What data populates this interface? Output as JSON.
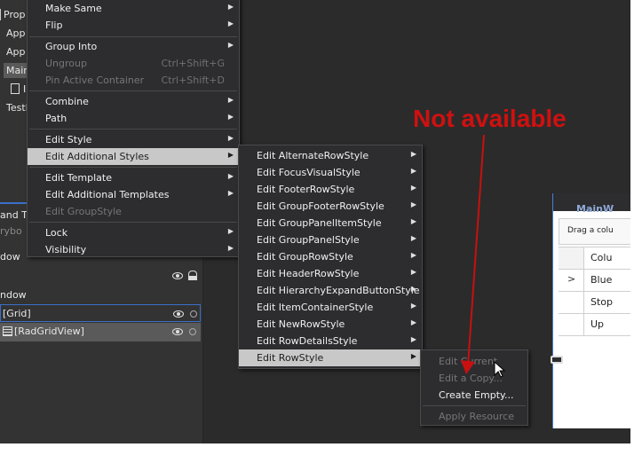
{
  "left_panel": {
    "top_items": [
      "Prop",
      "App",
      "App",
      "Main",
      "I",
      "TestI"
    ],
    "section_labels": [
      "and T",
      "rybo",
      "dow",
      "ndow"
    ],
    "tree": [
      {
        "label": "[Grid]"
      },
      {
        "label": "[RadGridView]"
      }
    ]
  },
  "context_menu": {
    "items": [
      {
        "label": "Make Same",
        "submenu": true
      },
      {
        "label": "Flip",
        "submenu": true
      },
      {
        "label": "Group Into",
        "submenu": true
      },
      {
        "label": "Ungroup",
        "shortcut": "Ctrl+Shift+G",
        "disabled": true
      },
      {
        "label": "Pin Active Container",
        "shortcut": "Ctrl+Shift+D",
        "disabled": true
      },
      {
        "label": "Combine",
        "submenu": true
      },
      {
        "label": "Path",
        "submenu": true
      },
      {
        "label": "Edit Style",
        "submenu": true
      },
      {
        "label": "Edit Additional Styles",
        "submenu": true,
        "highlighted": true
      },
      {
        "label": "Edit Template",
        "submenu": true
      },
      {
        "label": "Edit Additional Templates",
        "submenu": true
      },
      {
        "label": "Edit GroupStyle",
        "disabled": true
      },
      {
        "label": "Lock",
        "submenu": true
      },
      {
        "label": "Visibility",
        "submenu": true
      }
    ]
  },
  "styles_submenu": {
    "items": [
      "Edit AlternateRowStyle",
      "Edit FocusVisualStyle",
      "Edit FooterRowStyle",
      "Edit GroupFooterRowStyle",
      "Edit GroupPanelItemStyle",
      "Edit GroupPanelStyle",
      "Edit GroupRowStyle",
      "Edit HeaderRowStyle",
      "Edit HierarchyExpandButtonStyle",
      "Edit ItemContainerStyle",
      "Edit NewRowStyle",
      "Edit RowDetailsStyle",
      "Edit RowStyle"
    ]
  },
  "rowstyle_submenu": {
    "items": [
      {
        "label": "Edit Current",
        "disabled": true
      },
      {
        "label": "Edit a Copy...",
        "disabled": true
      },
      {
        "label": "Create Empty...",
        "disabled": false
      },
      {
        "label": "Apply Resource",
        "disabled": true
      }
    ]
  },
  "designer": {
    "window_title": "MainW",
    "group_panel_text": "Drag a colu",
    "rows": [
      {
        "indicator": "",
        "value": "Colu"
      },
      {
        "indicator": ">",
        "value": "Blue"
      },
      {
        "indicator": "",
        "value": "Stop"
      },
      {
        "indicator": "",
        "value": "Up"
      }
    ]
  },
  "annotation": {
    "text": "Not available",
    "color": "#d01010"
  }
}
